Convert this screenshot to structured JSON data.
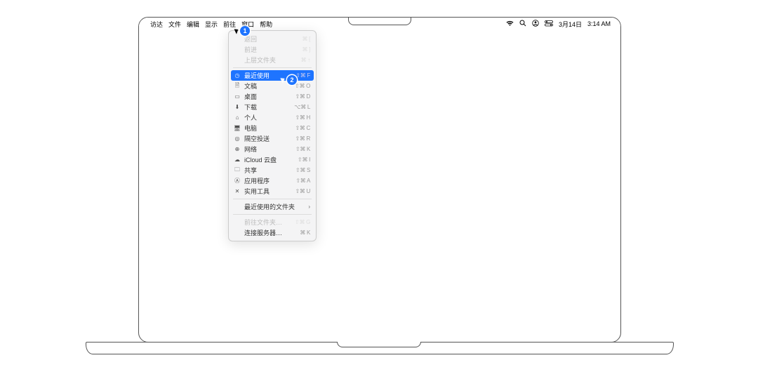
{
  "menubar": {
    "items": [
      "访达",
      "文件",
      "编辑",
      "显示",
      "前往",
      "窗口",
      "帮助"
    ],
    "active_index": 4,
    "status": {
      "date": "3月14日",
      "time": "3:14 AM"
    }
  },
  "dropdown": {
    "groups": [
      [
        {
          "icon": "",
          "label": "返回",
          "shortcut": "⌘ [",
          "disabled": true
        },
        {
          "icon": "",
          "label": "前进",
          "shortcut": "⌘ ]",
          "disabled": true
        },
        {
          "icon": "",
          "label": "上层文件夹",
          "shortcut": "⌘ ↑",
          "disabled": true
        }
      ],
      [
        {
          "icon": "◷",
          "icon_name": "clock-icon",
          "label": "最近使用",
          "shortcut": "⇧⌘ F",
          "highlighted": true
        },
        {
          "icon": "🗎",
          "icon_name": "document-icon",
          "label": "文稿",
          "shortcut": "⇧⌘ O"
        },
        {
          "icon": "▭",
          "icon_name": "desktop-icon",
          "label": "桌面",
          "shortcut": "⇧⌘ D"
        },
        {
          "icon": "⬇",
          "icon_name": "download-icon",
          "label": "下载",
          "shortcut": "⌥⌘ L"
        },
        {
          "icon": "⌂",
          "icon_name": "home-icon",
          "label": "个人",
          "shortcut": "⇧⌘ H"
        },
        {
          "icon": "🖥",
          "icon_name": "computer-icon",
          "label": "电脑",
          "shortcut": "⇧⌘ C"
        },
        {
          "icon": "◎",
          "icon_name": "airdrop-icon",
          "label": "隔空投送",
          "shortcut": "⇧⌘ R"
        },
        {
          "icon": "⊕",
          "icon_name": "network-icon",
          "label": "网络",
          "shortcut": "⇧⌘ K"
        },
        {
          "icon": "☁",
          "icon_name": "cloud-icon",
          "label": "iCloud 云盘",
          "shortcut": "⇧⌘ I"
        },
        {
          "icon": "🗀",
          "icon_name": "shared-icon",
          "label": "共享",
          "shortcut": "⇧⌘ S"
        },
        {
          "icon": "Ⓐ",
          "icon_name": "apps-icon",
          "label": "应用程序",
          "shortcut": "⇧⌘ A"
        },
        {
          "icon": "✕",
          "icon_name": "utilities-icon",
          "label": "实用工具",
          "shortcut": "⇧⌘ U"
        }
      ],
      [
        {
          "icon": "",
          "label": "最近使用的文件夹",
          "submenu": true
        }
      ],
      [
        {
          "icon": "",
          "label": "前往文件夹…",
          "shortcut": "⇧⌘ G",
          "disabled": true
        },
        {
          "icon": "",
          "label": "连接服务器…",
          "shortcut": "⌘ K"
        }
      ]
    ]
  },
  "markers": {
    "m1": "1",
    "m2": "2"
  }
}
